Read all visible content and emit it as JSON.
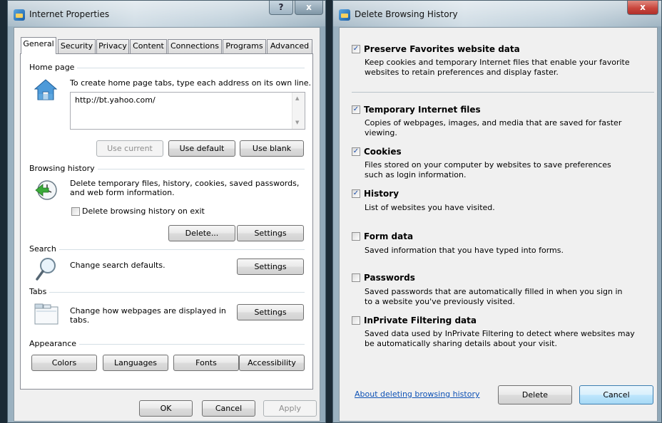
{
  "internet_properties": {
    "title": "Internet Properties",
    "help_glyph": "?",
    "close_glyph": "x",
    "tabs": [
      {
        "label": "General"
      },
      {
        "label": "Security"
      },
      {
        "label": "Privacy"
      },
      {
        "label": "Content"
      },
      {
        "label": "Connections"
      },
      {
        "label": "Programs"
      },
      {
        "label": "Advanced"
      }
    ],
    "home_page": {
      "group_label": "Home page",
      "description": "To create home page tabs, type each address on its own line.",
      "address_value": "http://bt.yahoo.com/",
      "use_current_label": "Use current",
      "use_default_label": "Use default",
      "use_blank_label": "Use blank"
    },
    "browsing_history": {
      "group_label": "Browsing history",
      "description_line1": "Delete temporary files, history, cookies, saved passwords,",
      "description_line2": "and web form information.",
      "delete_on_exit_label": "Delete browsing history on exit",
      "delete_label": "Delete...",
      "settings_label": "Settings"
    },
    "search": {
      "group_label": "Search",
      "description": "Change search defaults.",
      "settings_label": "Settings"
    },
    "tabs_group": {
      "group_label": "Tabs",
      "description_line1": "Change how webpages are displayed in",
      "description_line2": "tabs.",
      "settings_label": "Settings"
    },
    "appearance": {
      "group_label": "Appearance",
      "colors_label": "Colors",
      "languages_label": "Languages",
      "fonts_label": "Fonts",
      "accessibility_label": "Accessibility"
    },
    "footer": {
      "ok_label": "OK",
      "cancel_label": "Cancel",
      "apply_label": "Apply"
    }
  },
  "delete_browsing_history": {
    "title": "Delete Browsing History",
    "close_glyph": "x",
    "options": [
      {
        "label": "Preserve Favorites website data",
        "checked": true,
        "desc1": "Keep cookies and temporary Internet files that enable your favorite",
        "desc2": "websites to retain preferences and display faster."
      },
      {
        "label": "Temporary Internet files",
        "checked": true,
        "desc1": "Copies of webpages, images, and media that are saved for faster",
        "desc2": "viewing."
      },
      {
        "label": "Cookies",
        "checked": true,
        "desc1": "Files stored on your computer by websites to save preferences",
        "desc2": "such as login information."
      },
      {
        "label": "History",
        "checked": true,
        "desc1": "List of websites you have visited.",
        "desc2": ""
      },
      {
        "label": "Form data",
        "checked": false,
        "desc1": "Saved information that you have typed into forms.",
        "desc2": ""
      },
      {
        "label": "Passwords",
        "checked": false,
        "desc1": "Saved passwords that are automatically filled in when you sign in",
        "desc2": "to a website you've previously visited."
      },
      {
        "label": "InPrivate Filtering data",
        "checked": false,
        "desc1": "Saved data used by InPrivate Filtering to detect where websites may",
        "desc2": "be automatically sharing details about your visit."
      }
    ],
    "check_glyph": "✓",
    "about_link": "About deleting browsing history",
    "delete_label": "Delete",
    "cancel_label": "Cancel"
  },
  "colors": {
    "link": "#0d51b5",
    "close_red": "#c9463d",
    "accent_blue": "#3c7fb1"
  }
}
